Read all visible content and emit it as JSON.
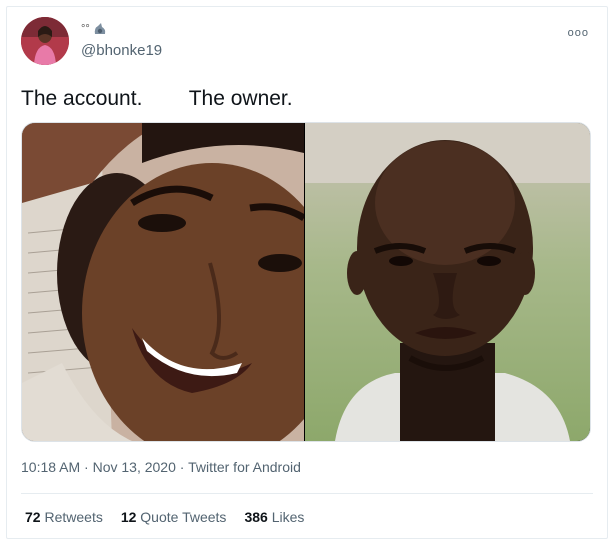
{
  "tweet": {
    "display_name_emoji": "°°",
    "display_name_icon": "blurred-emoji-icon",
    "handle": "@bhonke19",
    "more_glyph": "ooo",
    "text": "The account.        The owner.",
    "timestamp": "10:18 AM · Nov 13, 2020 · Twitter for Android",
    "stats": {
      "retweets_count": "72",
      "retweets_label": "Retweets",
      "quotes_count": "12",
      "quotes_label": "Quote Tweets",
      "likes_count": "386",
      "likes_label": "Likes"
    }
  },
  "colors": {
    "muted_text": "#536471",
    "primary_text": "#0f1419",
    "divider": "#e6ecf0"
  }
}
